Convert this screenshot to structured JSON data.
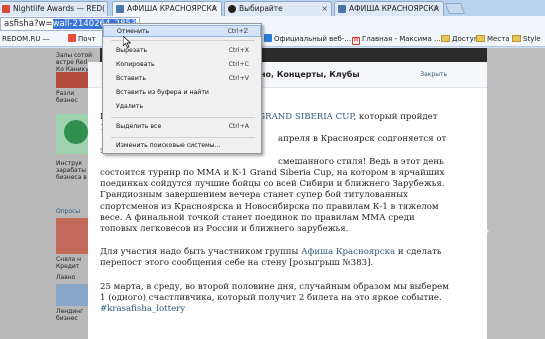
{
  "tabs": [
    {
      "label": "Nightlife Awards — RED(",
      "color": "#d64a3a"
    },
    {
      "label": "АФИША КРАСНОЯРСКА",
      "color": "#4a76a8"
    },
    {
      "label": "Выбирайте",
      "color": "#222222"
    },
    {
      "label": "АФИША КРАСНОЯРСКА",
      "color": "#4a76a8"
    }
  ],
  "address": {
    "prefix": "asfisha?w=",
    "selected": "wall-2140264_2853"
  },
  "bookmarks": [
    {
      "label": "REDOM.RU — ",
      "icon_color": "#c0392b"
    },
    {
      "label": "Почт",
      "icon_color": "#e74c3c"
    },
    {
      "label": "Официальный веб-...",
      "icon_color": "#2c7ed6"
    },
    {
      "label": "Главная - Максима ...",
      "icon_color": "#d93025"
    },
    {
      "label": "Доступ",
      "icon": "folder-icon"
    },
    {
      "label": "Места",
      "icon": "folder-icon"
    },
    {
      "label": "Style",
      "icon": "folder-icon"
    }
  ],
  "sidebar": {
    "items": [
      {
        "text": "Залы сотой встре Red Ко Каникул"
      },
      {
        "text": "Разли бизнес"
      },
      {
        "text": "Инструк зарабаты бизнеса в"
      },
      {
        "text": "Опросы"
      },
      {
        "text": "Опроси"
      },
      {
        "text": "Сняла н Кредит"
      },
      {
        "text": "Лавно"
      },
      {
        "text": "Лендинг бизнес"
      }
    ]
  },
  "post": {
    "title": "но, Концерты, Клубы",
    "close_label": "Закрыть",
    "paragraph1_link": "GRAND SIBERIA CUP",
    "paragraph1_after_link": ", который пройдет 11",
    "paragraph1_line2": "апреля в Красноярск содгоняется от эмоций",
    "paragraph1_line3": "смешанного стиля! Ведь в этот день",
    "paragraph1_rest": "состоится турнир по ММА и К-1 Grand Siberia Cup, на котором в ярчайших поединках сойдутся лучшие бойцы со всей Сибири и ближнего Зарубежья. Грандиозным завершением вечера станет супер бой титулованных спортсменов из Красноярска и Новосибирска по правилам К-1 в тяжелом весе. А финальной точкой станет поединок по правилам ММА среди топовых легковесов из России и ближнего зарубежья.",
    "paragraph2_before": "Для участия надо быть участником группы ",
    "paragraph2_link": "Афиша Красноярска",
    "paragraph2_after": " и сделать перепост этого сообщения себе на стену [розыгрыш №383].",
    "paragraph3": "25 марта, в среду, во второй половине дня, случайным образом мы выберем 1 (одного) счастливчика, который получит 2 билета на это яркое событие.",
    "hashtag": "#krasafisha_lottery",
    "first_letter": "Н"
  },
  "context_menu": {
    "items": [
      {
        "label": "Отменить",
        "shortcut": "Ctrl+Z",
        "highlighted": true
      },
      {
        "label": "Вырезать",
        "shortcut": "Ctrl+X"
      },
      {
        "label": "Копировать",
        "shortcut": "Ctrl+C"
      },
      {
        "label": "Вставить",
        "shortcut": "Ctrl+V"
      },
      {
        "label": "Вставить из буфера и найти",
        "shortcut": ""
      },
      {
        "label": "Удалить",
        "shortcut": ""
      },
      {
        "label": "Выделить все",
        "shortcut": "Ctrl+A"
      },
      {
        "label": "Изменить поисковые системы...",
        "shortcut": ""
      }
    ]
  },
  "colors": {
    "link": "#2b587a",
    "highlight": "#d4e3f8",
    "selection": "#3875d7"
  }
}
